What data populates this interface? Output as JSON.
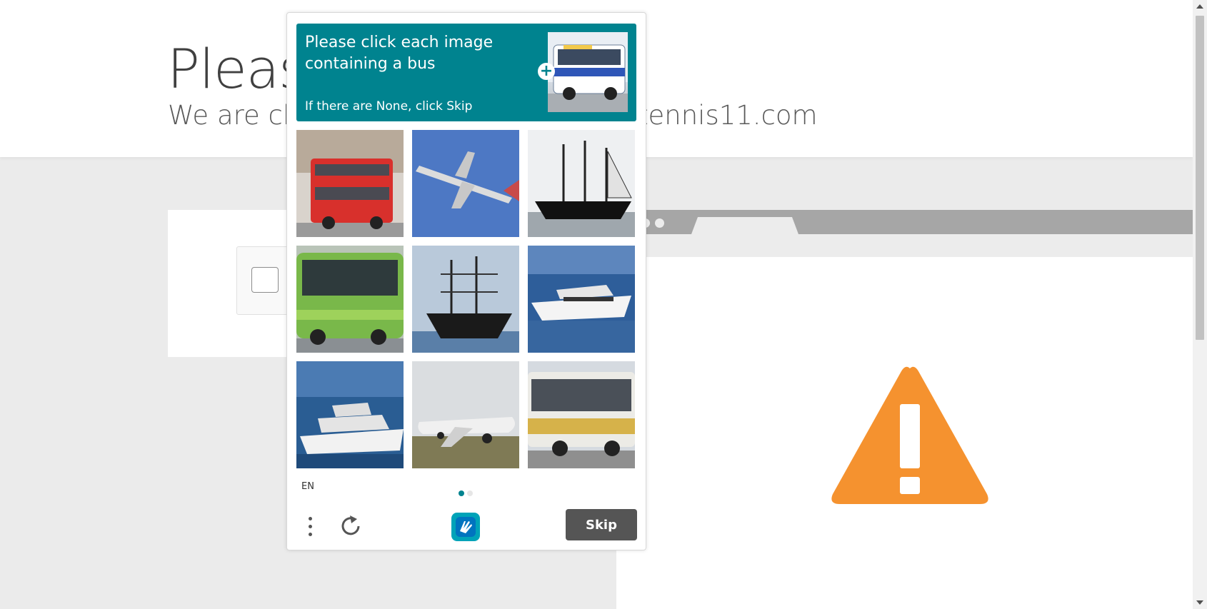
{
  "page": {
    "title": "Please",
    "subtitle_left": "We are che",
    "subtitle_right": "tennis11.com"
  },
  "captcha": {
    "prompt_text": "Please click each image containing a bus",
    "prompt_sub": "If there are None, click Skip",
    "example_icon": "plus-icon",
    "tiles": [
      {
        "content": "red double-decker bus"
      },
      {
        "content": "airplane"
      },
      {
        "content": "sailing ship"
      },
      {
        "content": "green bus"
      },
      {
        "content": "sailing ship"
      },
      {
        "content": "yacht"
      },
      {
        "content": "yacht"
      },
      {
        "content": "airplane"
      },
      {
        "content": "bus"
      }
    ],
    "language": "EN",
    "pager": {
      "current": 1,
      "total": 2
    },
    "skip_label": "Skip"
  },
  "colors": {
    "accent": "#00838f",
    "warning": "#f5922f",
    "skip_button": "#555555"
  }
}
